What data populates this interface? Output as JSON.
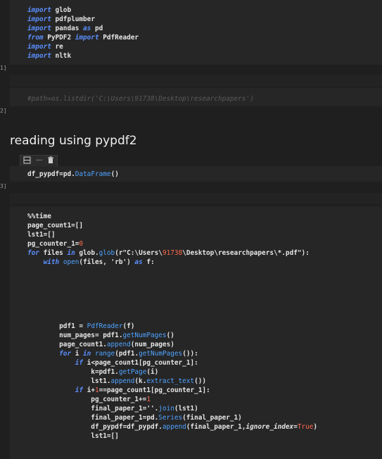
{
  "cells": [
    {
      "exec": "1]",
      "lines": [
        [
          [
            "kw",
            "import"
          ],
          [
            "txt",
            " glob"
          ]
        ],
        [
          [
            "kw",
            "import"
          ],
          [
            "txt",
            " pdfplumber"
          ]
        ],
        [
          [
            "kw",
            "import"
          ],
          [
            "txt",
            " pandas "
          ],
          [
            "kw",
            "as"
          ],
          [
            "txt",
            " pd"
          ]
        ],
        [
          [
            "kw",
            "from"
          ],
          [
            "txt",
            " PyPDF2 "
          ],
          [
            "kw",
            "import"
          ],
          [
            "txt",
            " PdfReader"
          ]
        ],
        [
          [
            "kw",
            "import"
          ],
          [
            "txt",
            " re"
          ]
        ],
        [
          [
            "kw",
            "import"
          ],
          [
            "txt",
            " nltk"
          ]
        ]
      ]
    },
    {
      "exec": "2]",
      "lines": [
        [
          [
            "cmt",
            "#path=os.listdir('C:\\Users\\91738\\Desktop\\researchpapers')"
          ]
        ]
      ]
    },
    {
      "exec": "3]",
      "lines": [
        [
          [
            "txt",
            "df_pypdf="
          ],
          [
            "txt",
            "pd."
          ],
          [
            "fn",
            "DataFrame"
          ],
          [
            "txt",
            "()"
          ]
        ]
      ]
    },
    {
      "exec": "",
      "lines": [
        [
          [
            "txt",
            "%%time"
          ]
        ],
        [
          [
            "txt",
            "page_count1=[]"
          ]
        ],
        [
          [
            "txt",
            "lst1=[]"
          ]
        ],
        [
          [
            "txt",
            "pg_counter_1="
          ],
          [
            "num",
            "0"
          ]
        ],
        [
          [
            "kw",
            "for"
          ],
          [
            "txt",
            " files "
          ],
          [
            "kw",
            "in"
          ],
          [
            "txt",
            " glob."
          ],
          [
            "fn",
            "glob"
          ],
          [
            "txt",
            "(r\"C:\\Users\\"
          ],
          [
            "num",
            "91738"
          ],
          [
            "txt",
            "\\Desktop\\researchpapers\\*.pdf\"):"
          ]
        ],
        [
          [
            "txt",
            "    "
          ],
          [
            "kw",
            "with"
          ],
          [
            "txt",
            " "
          ],
          [
            "fn",
            "open"
          ],
          [
            "txt",
            "(files, 'rb') "
          ],
          [
            "kw",
            "as"
          ],
          [
            "txt",
            " f:"
          ]
        ],
        [
          [
            "txt",
            ""
          ]
        ],
        [
          [
            "txt",
            ""
          ]
        ],
        [
          [
            "txt",
            ""
          ]
        ],
        [
          [
            "txt",
            ""
          ]
        ],
        [
          [
            "txt",
            ""
          ]
        ],
        [
          [
            "txt",
            ""
          ]
        ],
        [
          [
            "txt",
            "        pdf1 = "
          ],
          [
            "fn",
            "PdfReader"
          ],
          [
            "txt",
            "(f)"
          ]
        ],
        [
          [
            "txt",
            "        num_pages= pdf1."
          ],
          [
            "fn",
            "getNumPages"
          ],
          [
            "txt",
            "()"
          ]
        ],
        [
          [
            "txt",
            "        page_count1."
          ],
          [
            "fn",
            "append"
          ],
          [
            "txt",
            "(num_pages)"
          ]
        ],
        [
          [
            "txt",
            "        "
          ],
          [
            "kw",
            "for"
          ],
          [
            "txt",
            " i "
          ],
          [
            "kw",
            "in"
          ],
          [
            "txt",
            " "
          ],
          [
            "fn",
            "range"
          ],
          [
            "txt",
            "(pdf1."
          ],
          [
            "fn",
            "getNumPages"
          ],
          [
            "txt",
            "()):"
          ]
        ],
        [
          [
            "txt",
            "            "
          ],
          [
            "kw",
            "if"
          ],
          [
            "txt",
            " i<page_count1[pg_counter_1]:"
          ]
        ],
        [
          [
            "txt",
            "                k=pdf1."
          ],
          [
            "fn",
            "getPage"
          ],
          [
            "txt",
            "(i)"
          ]
        ],
        [
          [
            "txt",
            "                lst1."
          ],
          [
            "fn",
            "append"
          ],
          [
            "txt",
            "(k."
          ],
          [
            "fn",
            "extract_text"
          ],
          [
            "txt",
            "())"
          ]
        ],
        [
          [
            "txt",
            "            "
          ],
          [
            "kw",
            "if"
          ],
          [
            "txt",
            " i+"
          ],
          [
            "num",
            "1"
          ],
          [
            "txt",
            "==page_count1[pg_counter_1]:"
          ]
        ],
        [
          [
            "txt",
            "                pg_counter_1+="
          ],
          [
            "num",
            "1"
          ]
        ],
        [
          [
            "txt",
            "                final_paper_1=''."
          ],
          [
            "fn",
            "join"
          ],
          [
            "txt",
            "(lst1)"
          ]
        ],
        [
          [
            "txt",
            "                final_paper_1=pd."
          ],
          [
            "fn",
            "Series"
          ],
          [
            "txt",
            "(final_paper_1)"
          ]
        ],
        [
          [
            "txt",
            "                df_pypdf=df_pypdf."
          ],
          [
            "fn",
            "append"
          ],
          [
            "txt",
            "(final_paper_1,"
          ],
          [
            "kwarg",
            "ignore_index"
          ],
          [
            "txt",
            "="
          ],
          [
            "bool",
            "True"
          ],
          [
            "txt",
            ")"
          ]
        ],
        [
          [
            "txt",
            "                lst1=[]"
          ]
        ]
      ]
    }
  ],
  "markdown_heading": "reading using pypdf2",
  "toolbar": {
    "split_icon": "split-cell-icon",
    "more_icon": "more-icon",
    "delete_icon": "trash-icon",
    "more_label": "···"
  },
  "colors": {
    "background": "#1f1f1f",
    "cell_background": "#262626",
    "keyword": "#5b8fff",
    "function": "#4fa3ff",
    "number": "#ff6a4d",
    "comment": "#5a5a5a"
  }
}
